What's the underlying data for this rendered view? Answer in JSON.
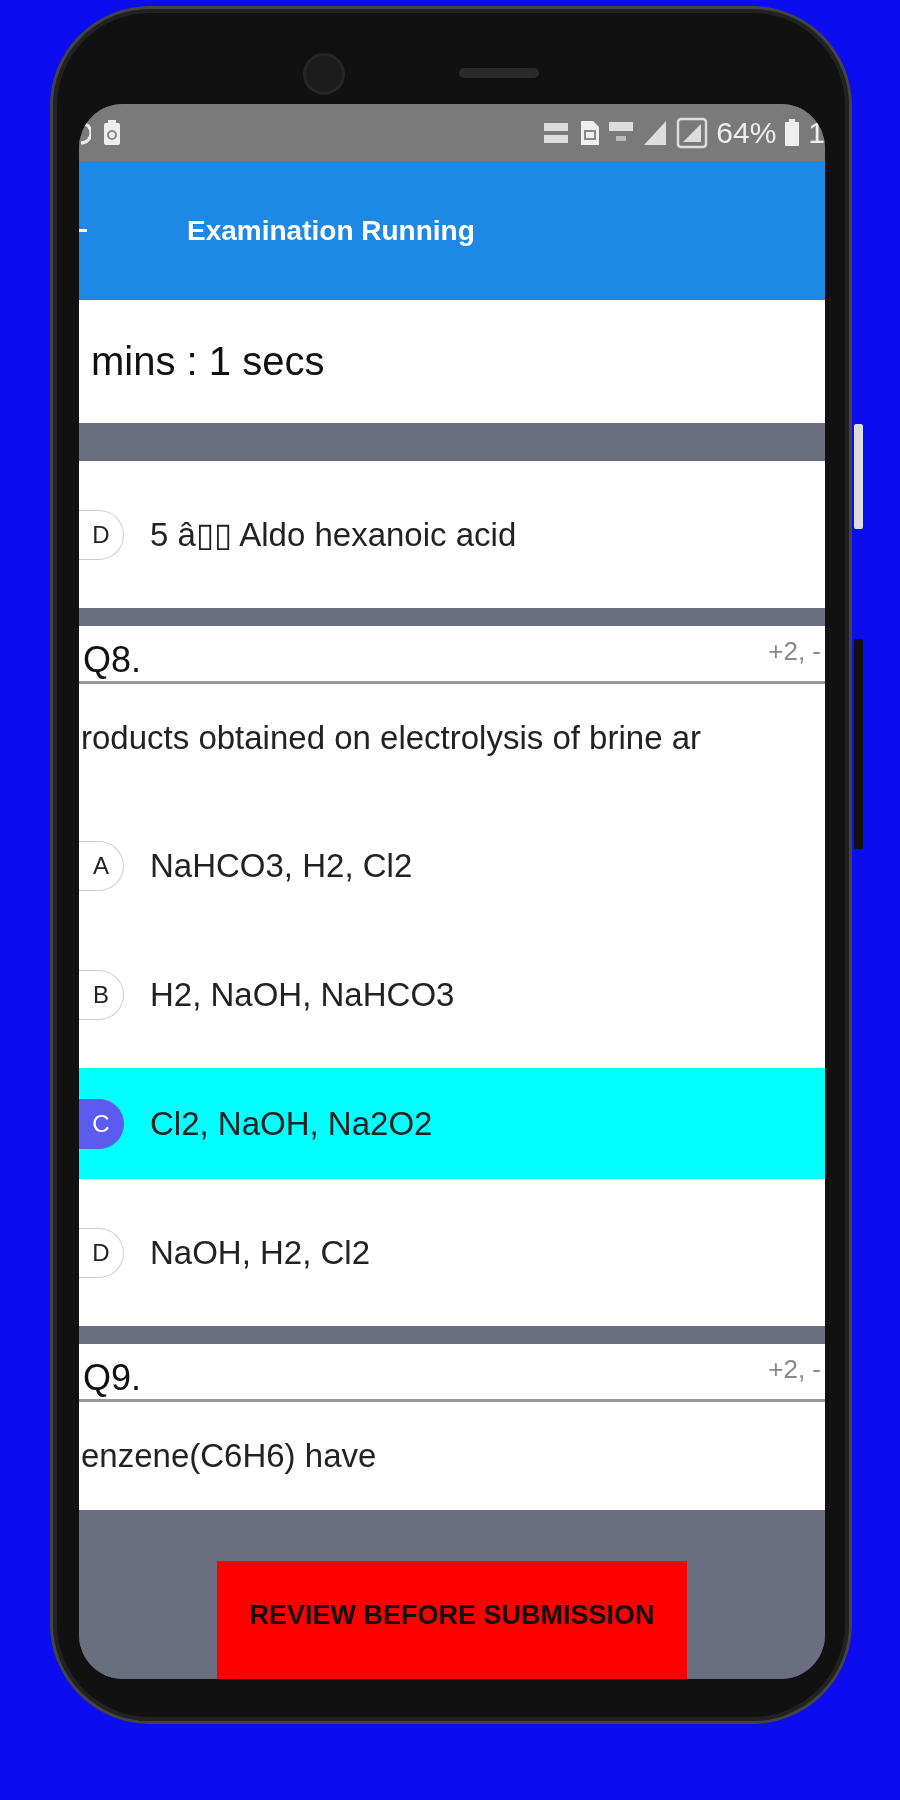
{
  "status_bar": {
    "battery": "64%",
    "time": "1"
  },
  "app_bar": {
    "title": "Examination Running"
  },
  "timer": "mins : 1 secs",
  "questions": [
    {
      "options": [
        {
          "letter": "D",
          "text": "5 â▯▯ Aldo hexanoic acid",
          "selected": false
        }
      ]
    },
    {
      "number": "Q8.",
      "marks": "+2, -",
      "text": "roducts obtained on electrolysis of brine ar",
      "options": [
        {
          "letter": "A",
          "text": "NaHCO3, H2, Cl2",
          "selected": false
        },
        {
          "letter": "B",
          "text": "H2, NaOH, NaHCO3",
          "selected": false
        },
        {
          "letter": "C",
          "text": "Cl2, NaOH, Na2O2",
          "selected": true
        },
        {
          "letter": "D",
          "text": "NaOH, H2, Cl2",
          "selected": false
        }
      ]
    },
    {
      "number": "Q9.",
      "marks": "+2, -",
      "text": "enzene(C6H6) have"
    }
  ],
  "review_button": "REVIEW BEFORE SUBMISSION"
}
